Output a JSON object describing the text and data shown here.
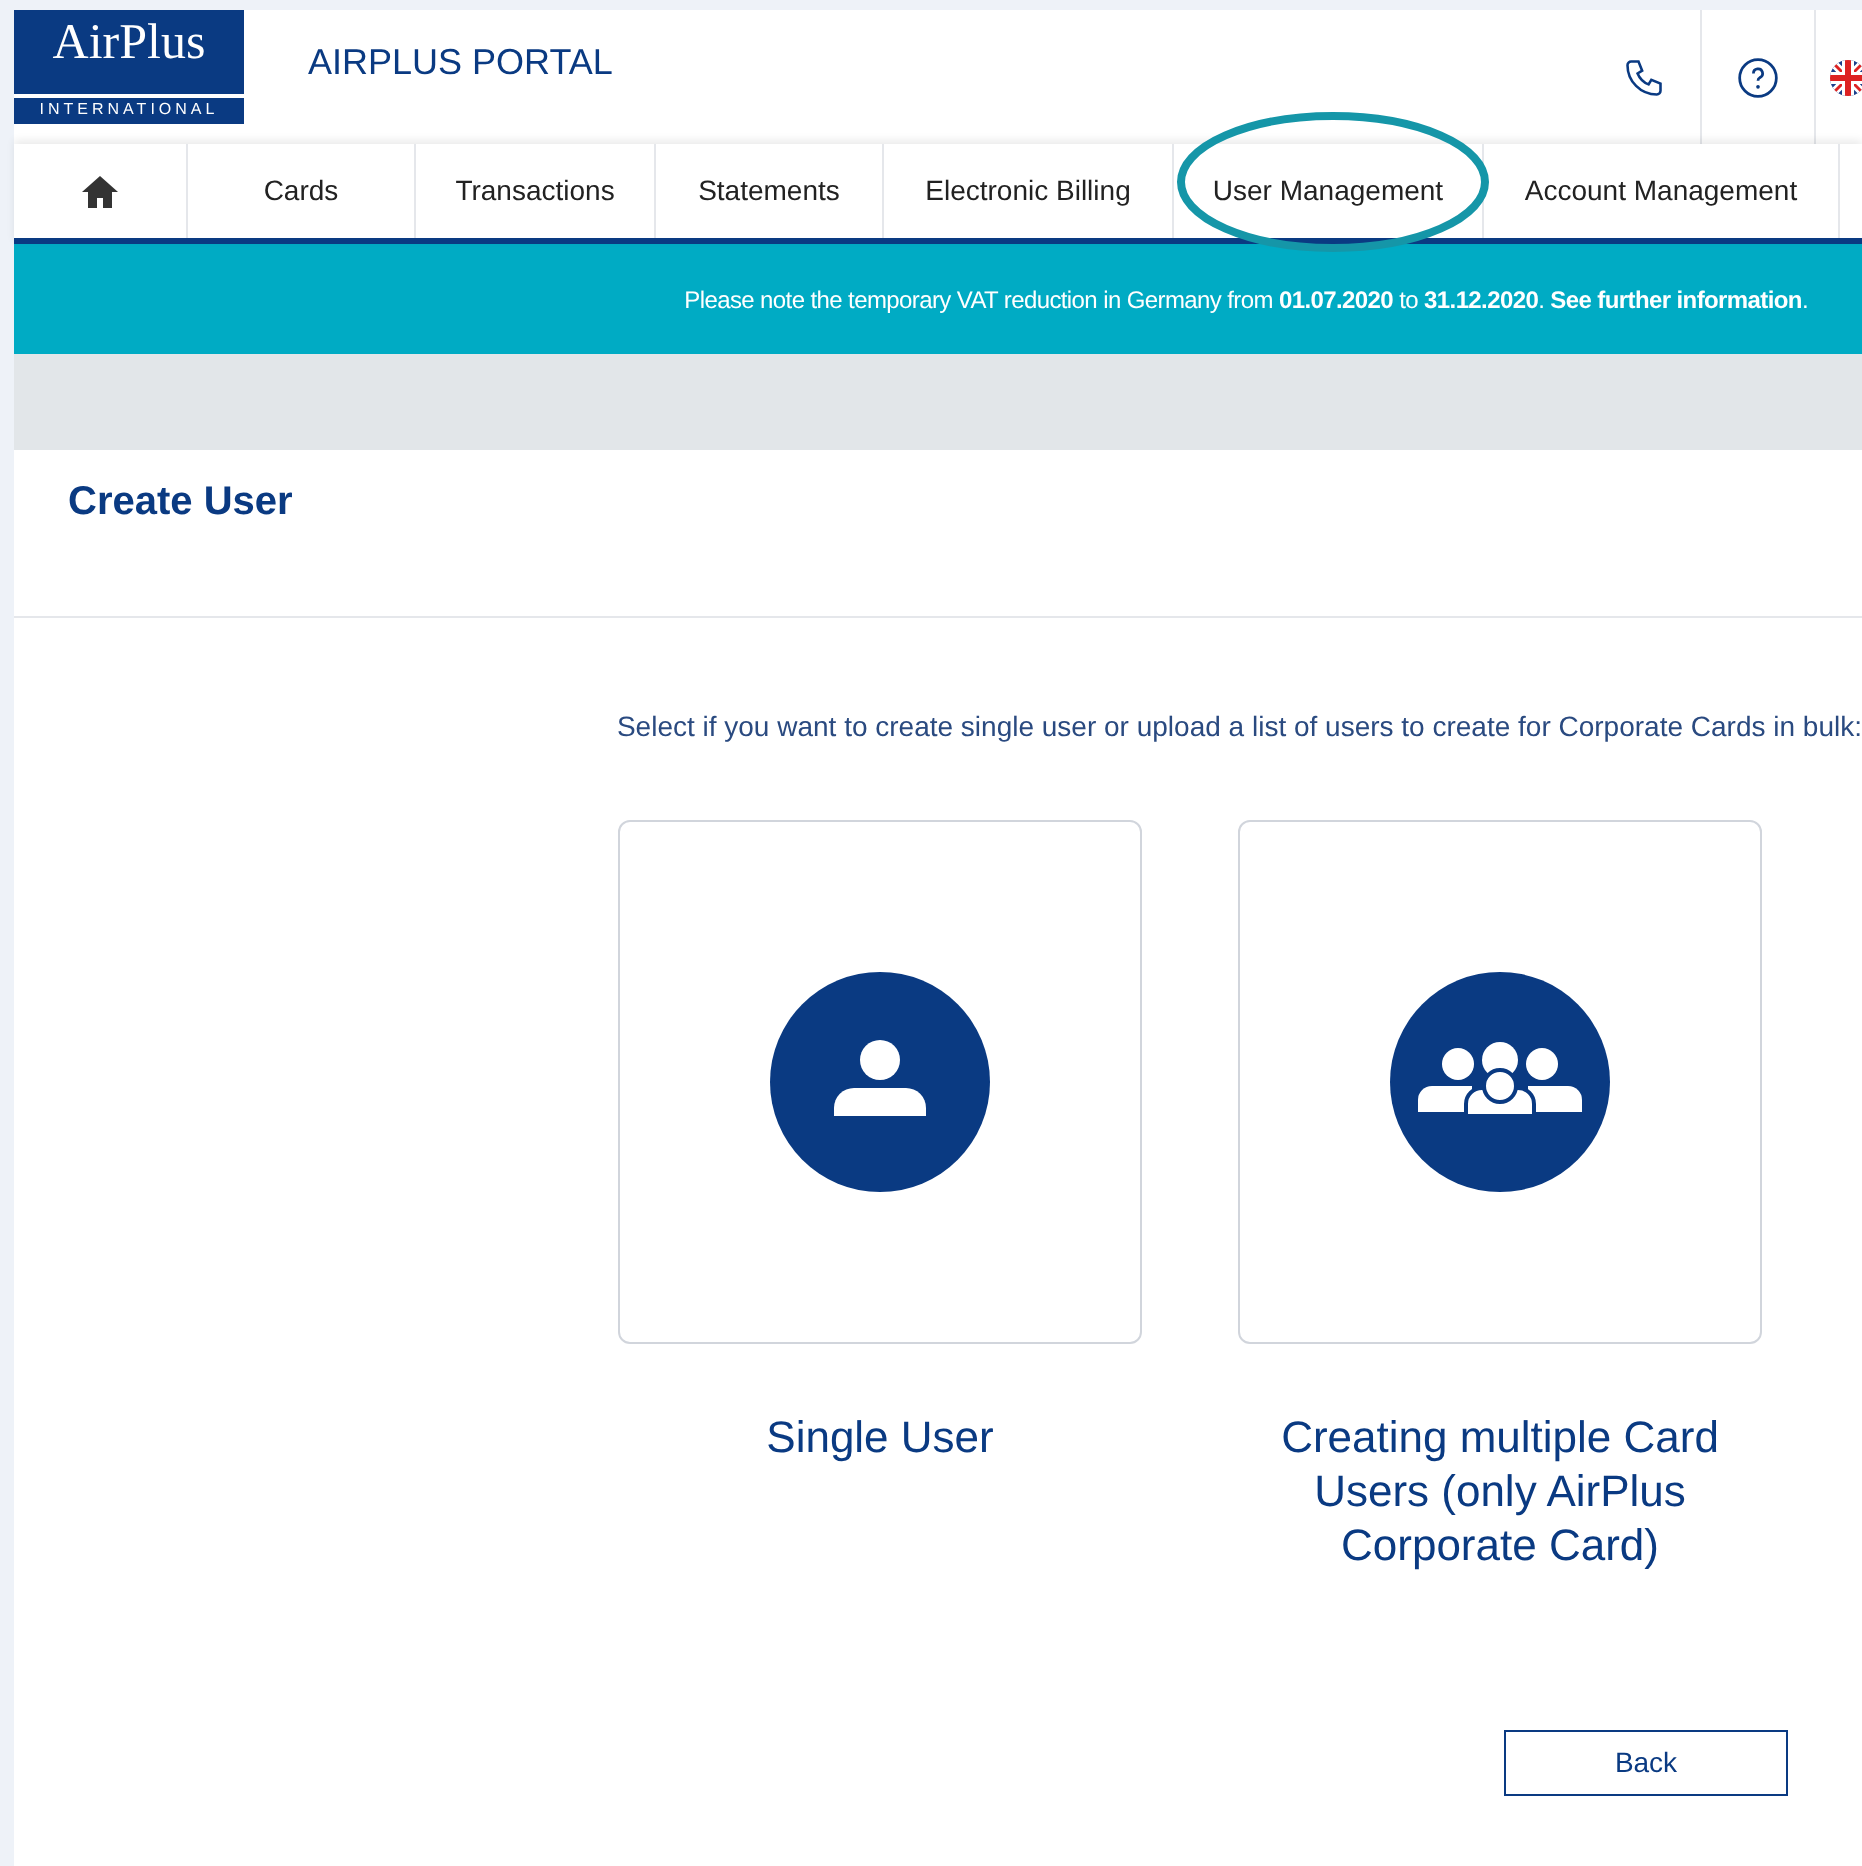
{
  "header": {
    "logo": {
      "name": "AirPlus",
      "tagline": "INTERNATIONAL"
    },
    "portal_title": "AIRPLUS PORTAL"
  },
  "nav": {
    "items": [
      {
        "kind": "home"
      },
      {
        "kind": "text",
        "label": "Cards"
      },
      {
        "kind": "text",
        "label": "Transactions"
      },
      {
        "kind": "text",
        "label": "Statements"
      },
      {
        "kind": "text",
        "label": "Electronic Billing"
      },
      {
        "kind": "text",
        "label": "User Management",
        "highlighted": true
      },
      {
        "kind": "text",
        "label": "Account Management"
      }
    ]
  },
  "banner": "Please note the temporary VAT reduction in Germany from **01.07.2020** to **31.12.2020**. **See further information**.",
  "page": {
    "title": "Create User",
    "instruction": "Select if you want to create single user or upload a list of users to create for Corporate Cards in bulk:",
    "options": [
      {
        "kind": "single",
        "label": "Single User"
      },
      {
        "kind": "multiple",
        "label": "Creating multiple Card Users (only AirPlus Corporate Card)"
      }
    ],
    "back_button": "Back"
  }
}
